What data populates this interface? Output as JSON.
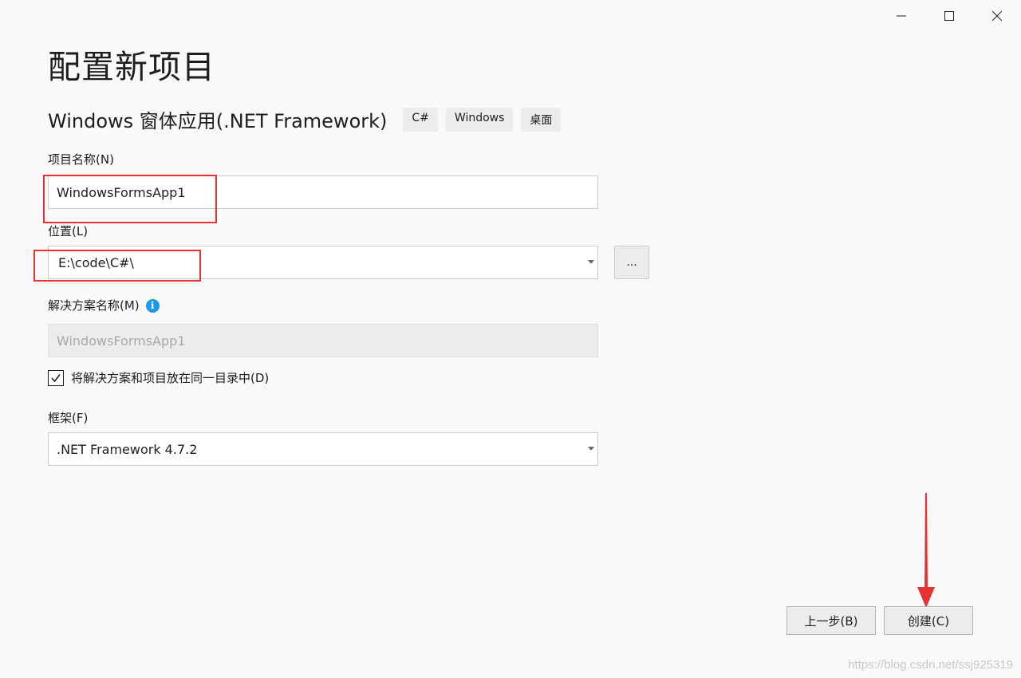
{
  "window": {
    "controls": [
      {
        "name": "minimize-button",
        "icon": "minimize-icon"
      },
      {
        "name": "maximize-button",
        "icon": "maximize-icon"
      },
      {
        "name": "close-button",
        "icon": "close-icon"
      }
    ]
  },
  "page": {
    "title": "配置新项目"
  },
  "template": {
    "name": "Windows 窗体应用(.NET Framework)",
    "tags": [
      "C#",
      "Windows",
      "桌面"
    ]
  },
  "form": {
    "project_name": {
      "label": "项目名称(N)",
      "value": "WindowsFormsApp1"
    },
    "location": {
      "label": "位置(L)",
      "value": "E:\\code\\C#\\",
      "browse_label": "..."
    },
    "solution_name": {
      "label": "解决方案名称(M)",
      "info_icon": "info-icon",
      "value": "WindowsFormsApp1",
      "disabled": true
    },
    "same_directory": {
      "label": "将解决方案和项目放在同一目录中(D)",
      "checked": true
    },
    "framework": {
      "label": "框架(F)",
      "value": ".NET Framework 4.7.2"
    }
  },
  "footer": {
    "back_label": "上一步(B)",
    "create_label": "创建(C)"
  },
  "annotations": {
    "highlight_color": "#e63232",
    "arrow_target": "create-button"
  },
  "watermark": "https://blog.csdn.net/ssj925319",
  "colors": {
    "background": "#f9f9f9",
    "info_blue": "#1c97ea"
  }
}
